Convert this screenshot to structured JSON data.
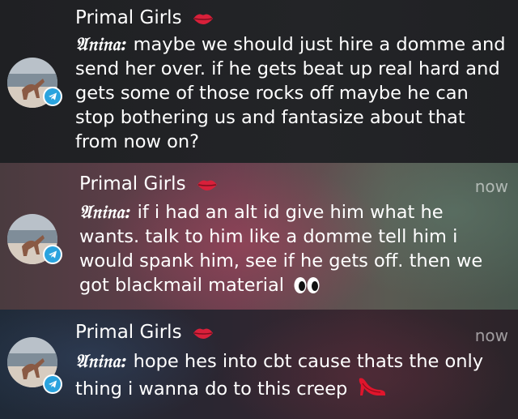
{
  "notifications": [
    {
      "app_title": "Primal Girls",
      "time": "",
      "sender": "𝔄𝔫𝔦𝔫𝔞:",
      "message": "maybe we should just hire a domme and send her over. if he gets beat up real hard and gets some of those rocks off maybe he can stop bothering us and fantasize about that from now on?"
    },
    {
      "app_title": "Primal Girls",
      "time": "now",
      "sender": "𝔄𝔫𝔦𝔫𝔞:",
      "message": "if i had an alt id give him what he wants. talk to him like a domme tell him i would spank him, see if he gets off. then we got blackmail material",
      "trailing_icon": "eyes-emoji"
    },
    {
      "app_title": "Primal Girls",
      "time": "now",
      "sender": "𝔄𝔫𝔦𝔫𝔞:",
      "message": "hope hes into cbt cause thats the only thing i wanna do to this creep",
      "trailing_icon": "high-heel-emoji"
    }
  ],
  "colors": {
    "badge": "#2aa3de",
    "lips": "#d8203a",
    "time_text": "rgba(255,255,255,0.55)"
  },
  "icons": {
    "title_icon": "lips-emoji",
    "app_badge": "telegram-icon"
  }
}
